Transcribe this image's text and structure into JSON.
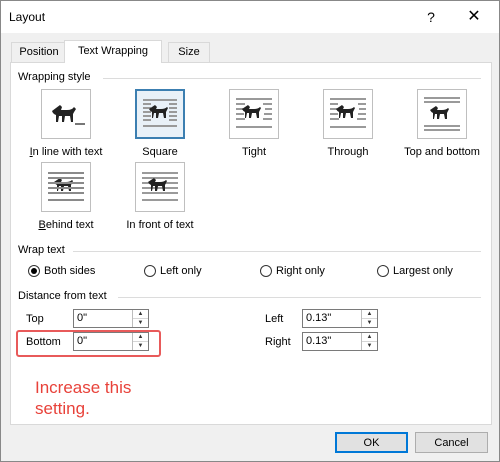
{
  "window": {
    "title": "Layout",
    "help": "?",
    "close": "✕"
  },
  "tabs": [
    {
      "label": "Position",
      "active": false
    },
    {
      "label": "Text Wrapping",
      "active": true
    },
    {
      "label": "Size",
      "active": false
    }
  ],
  "wrapping_style": {
    "label": "Wrapping style",
    "options": [
      {
        "label": "In line with text",
        "selected": false
      },
      {
        "label": "Square",
        "selected": true
      },
      {
        "label": "Tight",
        "selected": false
      },
      {
        "label": "Through",
        "selected": false
      },
      {
        "label": "Top and bottom",
        "selected": false
      },
      {
        "label": "Behind text",
        "selected": false
      },
      {
        "label": "In front of text",
        "selected": false
      }
    ]
  },
  "wrap_text": {
    "label": "Wrap text",
    "options": [
      {
        "label": "Both sides",
        "checked": true
      },
      {
        "label": "Left only",
        "checked": false
      },
      {
        "label": "Right only",
        "checked": false
      },
      {
        "label": "Largest only",
        "checked": false
      }
    ]
  },
  "distance": {
    "label": "Distance from text",
    "top_label": "Top",
    "top_value": "0\"",
    "bottom_label": "Bottom",
    "bottom_value": "0\"",
    "left_label": "Left",
    "left_value": "0.13\"",
    "right_label": "Right",
    "right_value": "0.13\""
  },
  "annotation": {
    "text": "Increase this setting.",
    "color": "#e8423a"
  },
  "buttons": {
    "ok": "OK",
    "cancel": "Cancel"
  },
  "colors": {
    "accent": "#0078d7",
    "selected_border": "#3c7fb1",
    "highlight": "#e85a5a"
  }
}
